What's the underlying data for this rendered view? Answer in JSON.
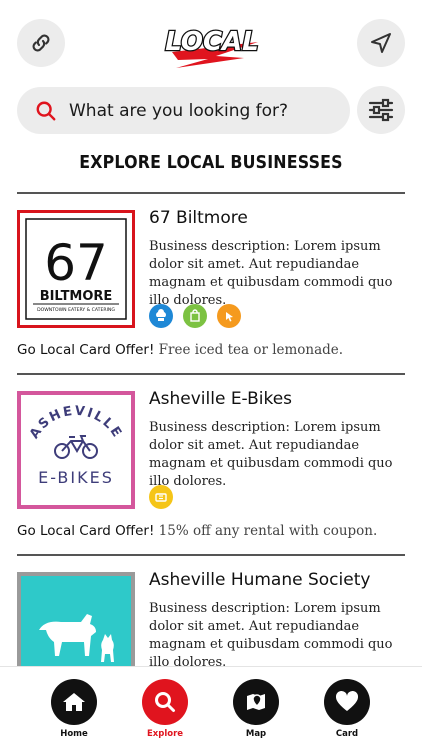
{
  "header": {
    "logo_text": "LOCAL",
    "link_icon": "link-icon",
    "navigate_icon": "navigation-arrow-icon"
  },
  "search": {
    "placeholder": "What are you looking for?",
    "search_icon": "search-icon",
    "filter_icon": "sliders-icon"
  },
  "section_title": "EXPLORE LOCAL BUSINESSES",
  "businesses": [
    {
      "name": "67 Biltmore",
      "description": "Business description: Lorem ipsum dolor sit amet. Aut repudiandae magnam et quibusdam commodi quo illo dolores.",
      "logo": {
        "number": "67",
        "word": "BILTMORE",
        "tagline": "DOWNTOWN EATERY & CATERING"
      },
      "offer_label": "Go Local Card Offer!",
      "offer_text": "Free iced tea or lemonade.",
      "tags": [
        {
          "icon": "chef-hat-icon",
          "color": "#1e88d6"
        },
        {
          "icon": "shopping-bag-icon",
          "color": "#7cc242"
        },
        {
          "icon": "cursor-click-icon",
          "color": "#f59a1e"
        }
      ]
    },
    {
      "name": "Asheville E-Bikes",
      "description": "Business description: Lorem ipsum dolor sit amet. Aut repudiandae magnam et quibusdam commodi quo illo dolores.",
      "logo": {
        "top": "ASHEVILLE",
        "bottom": "E-BIKES"
      },
      "offer_label": "Go Local Card Offer!",
      "offer_text": "15% off any rental with coupon.",
      "tags": [
        {
          "icon": "ticket-icon",
          "color": "#f5c518"
        }
      ]
    },
    {
      "name": "Asheville Humane Society",
      "description": "Business description: Lorem ipsum dolor sit amet. Aut repudiandae magnam et quibusdam commodi quo illo dolores.",
      "tags": [
        {
          "icon": "paw-icon",
          "color": "#7b3fa0"
        },
        {
          "icon": "heart-icon",
          "color": "#4fc3e8"
        }
      ]
    }
  ],
  "bottom_nav": [
    {
      "label": "Home",
      "icon": "home-icon"
    },
    {
      "label": "Explore",
      "icon": "search-icon",
      "active": true
    },
    {
      "label": "Map",
      "icon": "map-pin-icon"
    },
    {
      "label": "Card",
      "icon": "heart-icon"
    }
  ],
  "colors": {
    "brand_red": "#e0141e",
    "pill_gray": "#ececec",
    "ebikes_pink": "#d4579c",
    "humane_teal": "#2ec9c9"
  }
}
